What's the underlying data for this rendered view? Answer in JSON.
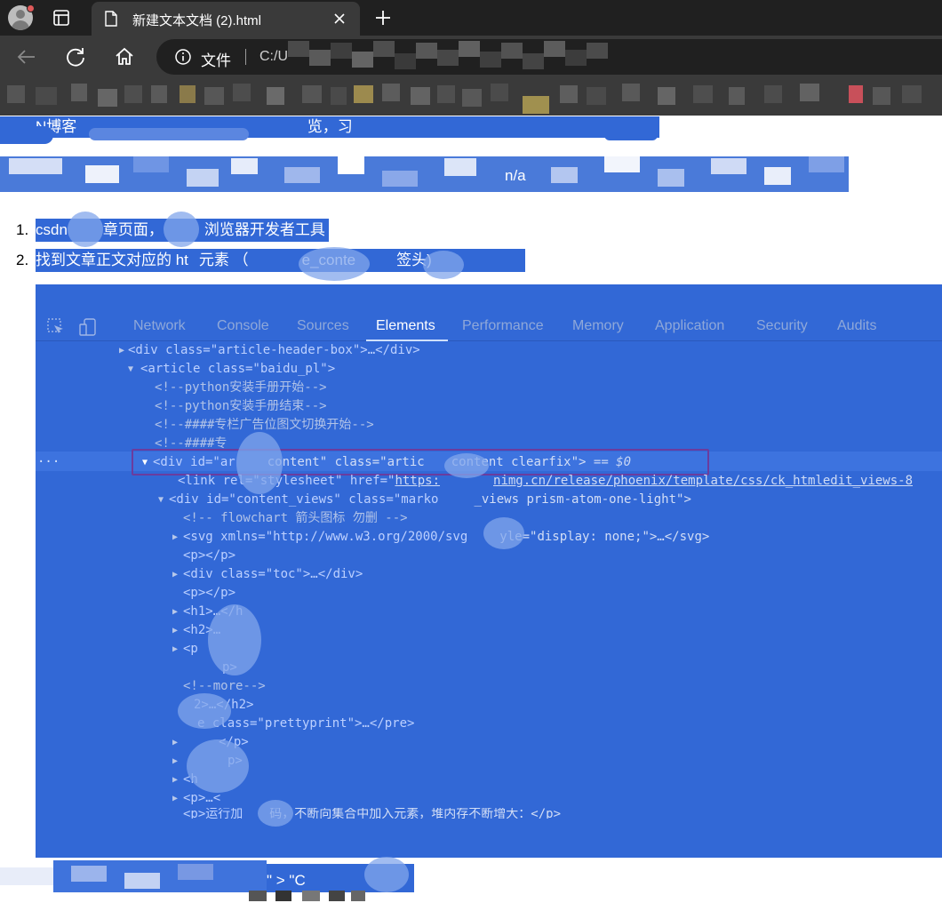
{
  "browser": {
    "tab_title": "新建文本文档 (2).html",
    "address_label": "文件",
    "address_url": "C:/U"
  },
  "content": {
    "line1_text": "N博客",
    "line1_mid": "览，习",
    "line2_tail": "n/a",
    "steps": [
      {
        "number": "1.",
        "text_a": "csdn",
        "text_b": "章页面，",
        "text_c": "浏览器开发者工具"
      },
      {
        "number": "2.",
        "text_a": "找到文章正文对应的 ht",
        "text_b": "元素  （",
        "text_c": "e_conte",
        "text_d": "签头)"
      }
    ],
    "bottom_text": "\" > \"C"
  },
  "devtools": {
    "tabs": [
      "Network",
      "Console",
      "Sources",
      "Elements",
      "Performance",
      "Memory",
      "Application",
      "Security",
      "Audits"
    ],
    "active_tab": "Elements",
    "ellipsis": "...",
    "lines": [
      "<div class=\"article-header-box\">…</div>",
      "<article class=\"baidu_pl\">",
      "<!--python安装手册开始-->",
      "<!--python安装手册结束-->",
      "<!--####专栏广告位图文切换开始-->",
      "<!--####专",
      "<div id=\"ar",
      "content\" class=\"artic",
      "content clearfix\">",
      "== $0",
      "<link rel=\"stylesheet\" href=\"",
      "https:",
      "nimg.cn/release/phoenix/template/css/ck_htmledit_views-8",
      "<div id=\"content_views\" class=\"marko",
      "_views prism-atom-one-light\">",
      "<!-- flowchart 箭头图标 勿删 -->",
      "<svg xmlns=\"http://www.w3.org/2000/svg",
      "yle=\"display: none;\">…</svg>",
      "<p></p>",
      "<div class=\"toc\">…</div>",
      "<p></p>",
      "<h1>…</h",
      "<h2>…",
      "<p",
      "p>",
      "<!--more-->",
      "2>…</h2>",
      "e class=\"prettyprint\">…</pre>",
      "</p>",
      "p>",
      "<h",
      "<p>…<",
      "<p>运行加",
      "码，不断向集合中加入元素，堆内存不断增大：</p>"
    ]
  },
  "colors": {
    "selection": "#3268d6",
    "chrome_dark": "#202020",
    "chrome_mid": "#3a3a3a",
    "highlight_border": "#6b3c9e"
  }
}
